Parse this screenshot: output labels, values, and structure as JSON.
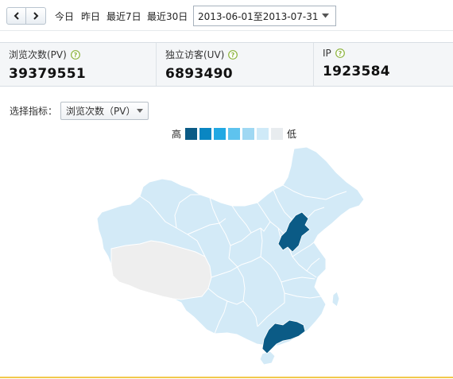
{
  "toolbar": {
    "quick_ranges": [
      "今日",
      "昨日",
      "最近7日",
      "最近30日"
    ],
    "date_range": "2013-06-01至2013-07-31"
  },
  "stats": [
    {
      "label": "浏览次数(PV)",
      "value": "39379551"
    },
    {
      "label": "独立访客(UV)",
      "value": "6893490"
    },
    {
      "label": "IP",
      "value": "1923584"
    }
  ],
  "selector": {
    "label": "选择指标：",
    "value": "浏览次数（PV）"
  },
  "legend": {
    "high_label": "高",
    "low_label": "低",
    "colors": [
      "#0b5b86",
      "#0a86c2",
      "#21a8e3",
      "#5ec3ee",
      "#9fd8f3",
      "#cfeaf8",
      "#e8ecef"
    ]
  },
  "map": {
    "colors": {
      "default": "#d3eaf7",
      "no_data": "#eeeeee",
      "highest": "#0b5b86",
      "border": "#ffffff"
    }
  },
  "icons": {
    "prev": "chevron-left-icon",
    "next": "chevron-right-icon",
    "help": "help-icon",
    "dropdown": "caret-down-icon"
  }
}
